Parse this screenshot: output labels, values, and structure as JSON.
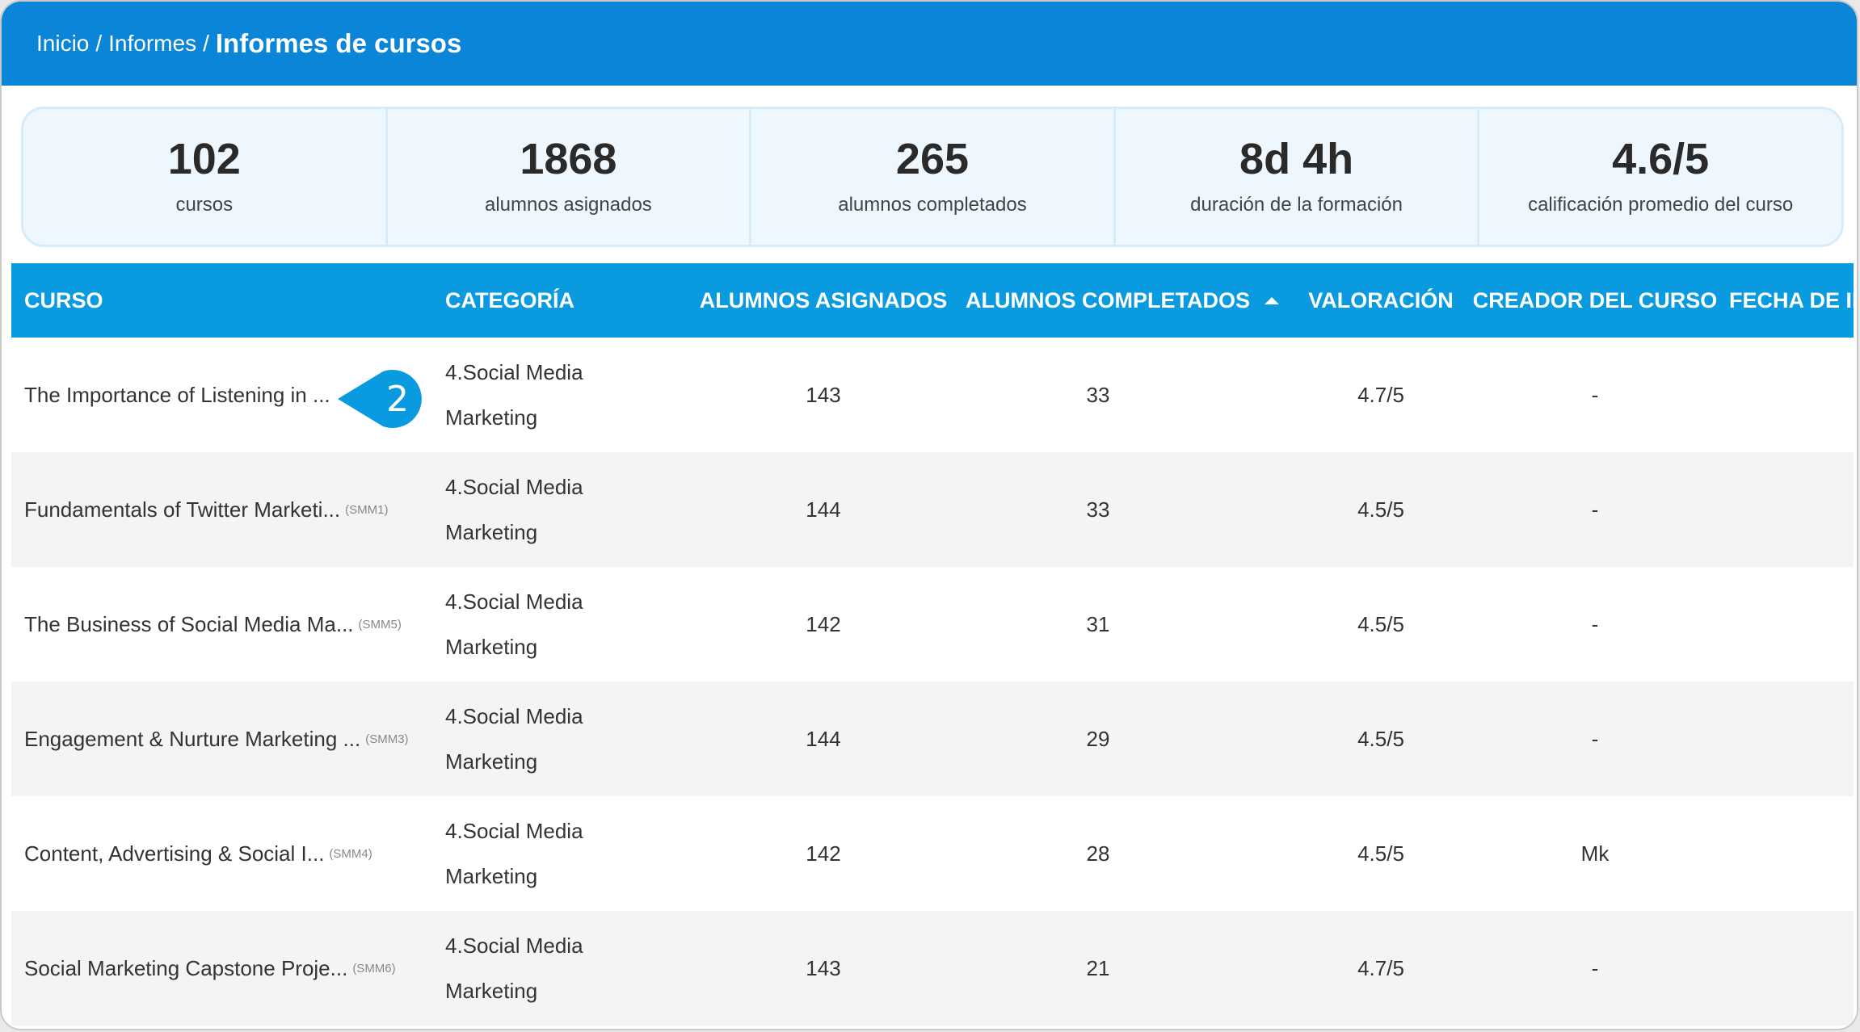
{
  "breadcrumb": {
    "home": "Inicio",
    "reports": "Informes",
    "current": "Informes de cursos",
    "separator": "/"
  },
  "stats": [
    {
      "value": "102",
      "label": "cursos"
    },
    {
      "value": "1868",
      "label": "alumnos asignados"
    },
    {
      "value": "265",
      "label": "alumnos completados"
    },
    {
      "value": "8d 4h",
      "label": "duración de la formación"
    },
    {
      "value": "4.6/5",
      "label": "calificación promedio del curso"
    }
  ],
  "table": {
    "headers": {
      "course": "CURSO",
      "category": "CATEGORÍA",
      "assigned": "ALUMNOS ASIGNADOS",
      "completed": "ALUMNOS COMPLETADOS",
      "rating": "VALORACIÓN",
      "creator": "CREADOR DEL CURSO",
      "date": "FECHA DE IN"
    },
    "sorted_column": "completed",
    "sort_direction": "ascending",
    "rows": [
      {
        "course": "The Importance of Listening in ...",
        "code": "",
        "category_line1": "4.Social Media",
        "category_line2": "Marketing",
        "assigned": "143",
        "completed": "33",
        "rating": "4.7/5",
        "creator": "-"
      },
      {
        "course": "Fundamentals of Twitter Marketi...",
        "code": "(SMM1)",
        "category_line1": "4.Social Media",
        "category_line2": "Marketing",
        "assigned": "144",
        "completed": "33",
        "rating": "4.5/5",
        "creator": "-"
      },
      {
        "course": "The Business of Social Media Ma...",
        "code": "(SMM5)",
        "category_line1": "4.Social Media",
        "category_line2": "Marketing",
        "assigned": "142",
        "completed": "31",
        "rating": "4.5/5",
        "creator": "-"
      },
      {
        "course": "Engagement & Nurture Marketing ...",
        "code": "(SMM3)",
        "category_line1": "4.Social Media",
        "category_line2": "Marketing",
        "assigned": "144",
        "completed": "29",
        "rating": "4.5/5",
        "creator": "-"
      },
      {
        "course": "Content, Advertising & Social I...",
        "code": "(SMM4)",
        "category_line1": "4.Social Media",
        "category_line2": "Marketing",
        "assigned": "142",
        "completed": "28",
        "rating": "4.5/5",
        "creator": "Mk"
      },
      {
        "course": "Social Marketing Capstone Proje...",
        "code": "(SMM6)",
        "category_line1": "4.Social Media",
        "category_line2": "Marketing",
        "assigned": "143",
        "completed": "21",
        "rating": "4.7/5",
        "creator": "-"
      }
    ]
  },
  "callout": {
    "number": "2",
    "color": "#0a9ae0"
  },
  "colors": {
    "header_bar": "#0a85d8",
    "table_header": "#0a9ae0",
    "stats_bg": "#eef7fd",
    "row_alt": "#f4f4f4"
  }
}
